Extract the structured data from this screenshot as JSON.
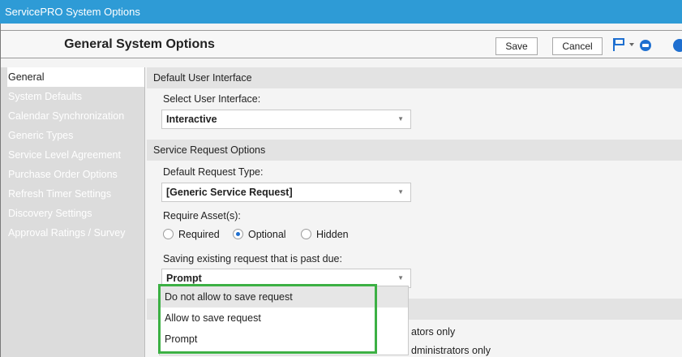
{
  "window": {
    "title": "ServicePRO  System Options"
  },
  "header": {
    "title": "General System Options",
    "save_label": "Save",
    "cancel_label": "Cancel"
  },
  "sidebar": {
    "items": [
      {
        "label": "General"
      },
      {
        "label": "System Defaults"
      },
      {
        "label": "Calendar Synchronization"
      },
      {
        "label": "Generic Types"
      },
      {
        "label": "Service Level Agreement"
      },
      {
        "label": "Purchase Order Options"
      },
      {
        "label": "Refresh Timer Settings"
      },
      {
        "label": "Discovery Settings"
      },
      {
        "label": "Approval Ratings / Survey"
      }
    ]
  },
  "main": {
    "section_ui": "Default User Interface",
    "select_ui_label": "Select User Interface:",
    "select_ui_value": "Interactive",
    "section_sr": "Service Request Options",
    "request_type_label": "Default Request Type:",
    "request_type_value": "[Generic Service Request]",
    "require_asset_label": "Require Asset(s):",
    "require_asset_options": [
      "Required",
      "Optional",
      "Hidden"
    ],
    "require_asset_selected": "Optional",
    "past_due_label": "Saving existing request that is past due:",
    "past_due_value": "Prompt",
    "obscured_line1": "ators only",
    "obscured_line2": "dministrators only"
  },
  "dropdown": {
    "options": [
      "Do not allow to save request",
      "Allow to save request",
      "Prompt"
    ],
    "hovered": "Do not allow to save request"
  },
  "colors": {
    "titlebar": "#2e9bd6",
    "highlight": "#3cb044",
    "radio_selected": "#1e6fd0"
  },
  "icons": [
    "flag-icon",
    "dropdown-arrow-icon",
    "circle-icon",
    "help-icon"
  ]
}
